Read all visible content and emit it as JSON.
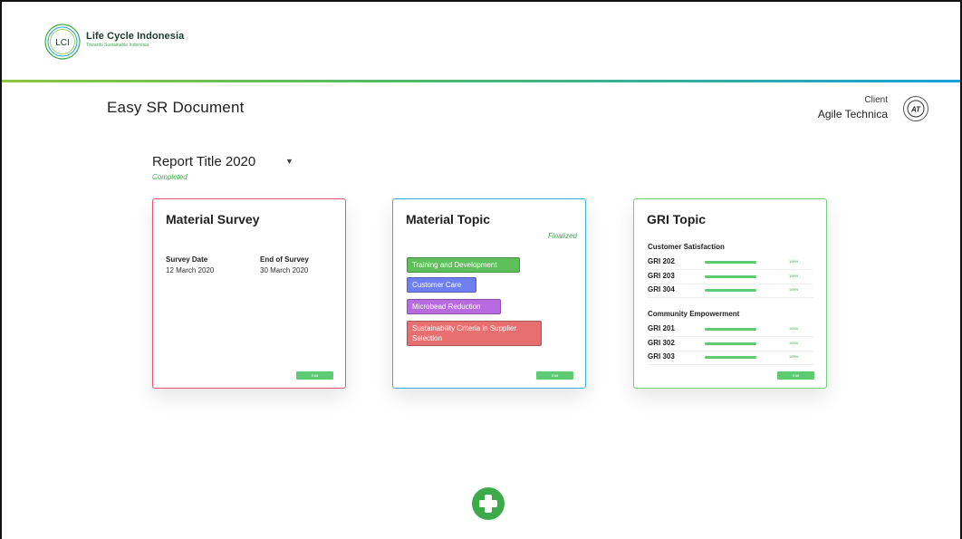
{
  "header": {
    "logo_text": "LCI",
    "brand_name": "Life Cycle Indonesia",
    "brand_tagline": "Towards Sustainable Indonesia",
    "accent_color": "#3daa4a"
  },
  "page": {
    "title": "Easy SR Document",
    "client_label": "Client",
    "client_name": "Agile Technica",
    "client_logo_text": "AT"
  },
  "report": {
    "title": "Report Title 2020",
    "status": "Completed"
  },
  "cards": {
    "survey": {
      "title": "Material Survey",
      "border_color": "#e8546c",
      "start_label": "Survey Date",
      "start_value": "12 March 2020",
      "end_label": "End of Survey",
      "end_value": "30 March 2020",
      "edit_label": "Edit"
    },
    "topic": {
      "title": "Material Topic",
      "border_color": "#3eaee6",
      "status": "Finalized",
      "tags": [
        {
          "label": "Training and Development",
          "color": "#5fbf5a"
        },
        {
          "label": "Customer Care",
          "color": "#6e7ff0"
        },
        {
          "label": "Microbead Reduction",
          "color": "#b86ae0"
        },
        {
          "label": "Sustainability Criteria in Supplier Selection",
          "color": "#e86f70"
        }
      ],
      "edit_label": "Edit"
    },
    "gri": {
      "title": "GRI Topic",
      "border_color": "#6fd27e",
      "groups": [
        {
          "name": "Customer Satisfaction",
          "items": [
            {
              "code": "GRI 202",
              "percent": "100%",
              "progress": 1.0
            },
            {
              "code": "GRI 203",
              "percent": "100%",
              "progress": 1.0
            },
            {
              "code": "GRI 304",
              "percent": "100%",
              "progress": 1.0
            }
          ]
        },
        {
          "name": "Community Empowerment",
          "items": [
            {
              "code": "GRI 201",
              "percent": "100%",
              "progress": 1.0
            },
            {
              "code": "GRI 302",
              "percent": "100%",
              "progress": 1.0
            },
            {
              "code": "GRI 303",
              "percent": "100%",
              "progress": 1.0
            }
          ]
        }
      ],
      "edit_label": "Edit"
    }
  },
  "actions": {
    "add_icon": "plus-circle-icon"
  }
}
